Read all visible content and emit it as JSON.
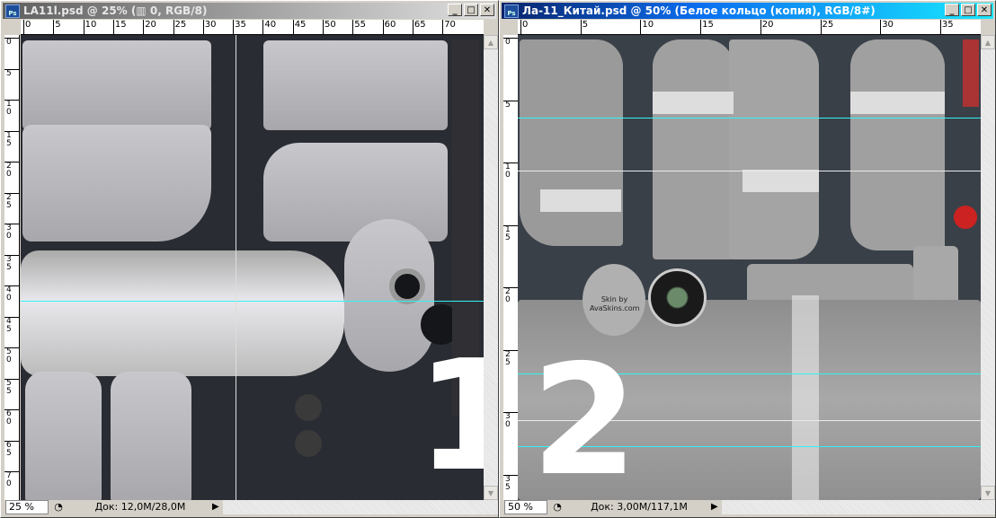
{
  "windows": [
    {
      "title": "LA11l.psd @ 25% (▥ 0, RGB/8)",
      "ruler_h": [
        "0",
        "5",
        "10",
        "15",
        "20",
        "25",
        "30",
        "35",
        "40",
        "45",
        "50",
        "55",
        "60",
        "65",
        "70"
      ],
      "ruler_v": [
        "0",
        "5",
        "10",
        "15",
        "20",
        "25",
        "30",
        "35",
        "40",
        "45",
        "50",
        "55",
        "60",
        "65",
        "70"
      ],
      "zoom": "25 %",
      "doc": "Док: 12,0M/28,0M",
      "overlay_number": "1"
    },
    {
      "title": "Ла-11_Китай.psd @ 50% (Белое кольцо (копия), RGB/8#)",
      "ruler_h": [
        "0",
        "5",
        "10",
        "15",
        "20",
        "25",
        "30",
        "35"
      ],
      "ruler_v": [
        "0",
        "5",
        "10",
        "15",
        "20",
        "25",
        "30",
        "35"
      ],
      "zoom": "50 %",
      "doc": "Док: 3,00M/117,1M",
      "overlay_number": "2",
      "skin_text": "Skin by AvaSkins.com"
    }
  ],
  "controls": {
    "minimize": "_",
    "maximize": "□",
    "close": "✕"
  },
  "ps_icon": "Ps"
}
